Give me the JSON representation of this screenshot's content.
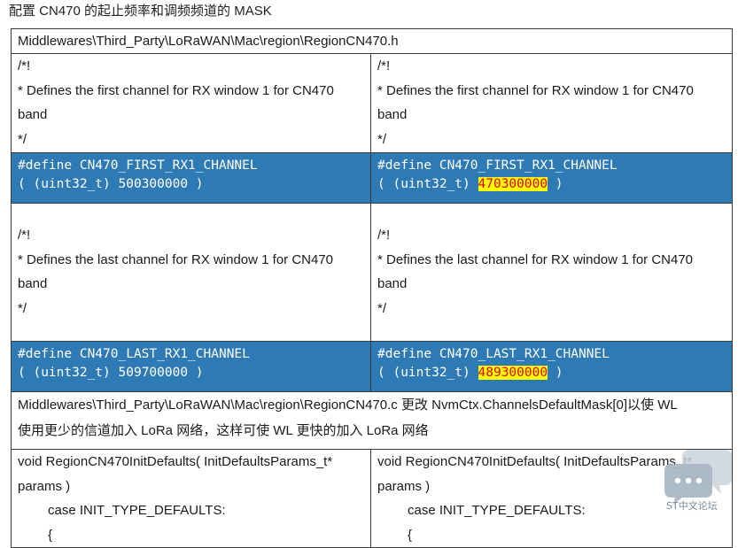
{
  "caption": "配置 CN470 的起止频率和调频频道的 MASK",
  "file_path": "Middlewares\\Third_Party\\LoRaWAN\\Mac\\region\\RegionCN470.h",
  "first_comment": {
    "open": "/*!",
    "text": " * Defines the first channel for RX window 1 for CN470",
    "text2": "band",
    "close": " */"
  },
  "first_define": {
    "line1": "#define CN470_FIRST_RX1_CHANNEL",
    "prefix": "( (uint32_t) ",
    "left_value": "500300000",
    "right_value": "470300000",
    "suffix": " )"
  },
  "last_comment": {
    "open": "/*!",
    "text": " * Defines the last channel for RX window 1 for CN470",
    "text2": "band",
    "close": " */"
  },
  "last_define": {
    "line1": "#define CN470_LAST_RX1_CHANNEL",
    "prefix": "( (uint32_t) ",
    "left_value": "509700000",
    "right_value": "489300000",
    "suffix": " )"
  },
  "note": {
    "line1": "Middlewares\\Third_Party\\LoRaWAN\\Mac\\region\\RegionCN470.c 更改 NvmCtx.ChannelsDefaultMask[0]以使 WL",
    "line2": "使用更少的信道加入 LoRa 网络，这样可使 WL 更快的加入 LoRa 网络"
  },
  "func": {
    "line1": "void RegionCN470InitDefaults( InitDefaultsParams_t*",
    "line2": "params )",
    "line3": "case INIT_TYPE_DEFAULTS:",
    "line4": "{"
  },
  "watermark": {
    "text": "ST中文论坛",
    "icon": "chat-bubble-icon"
  }
}
